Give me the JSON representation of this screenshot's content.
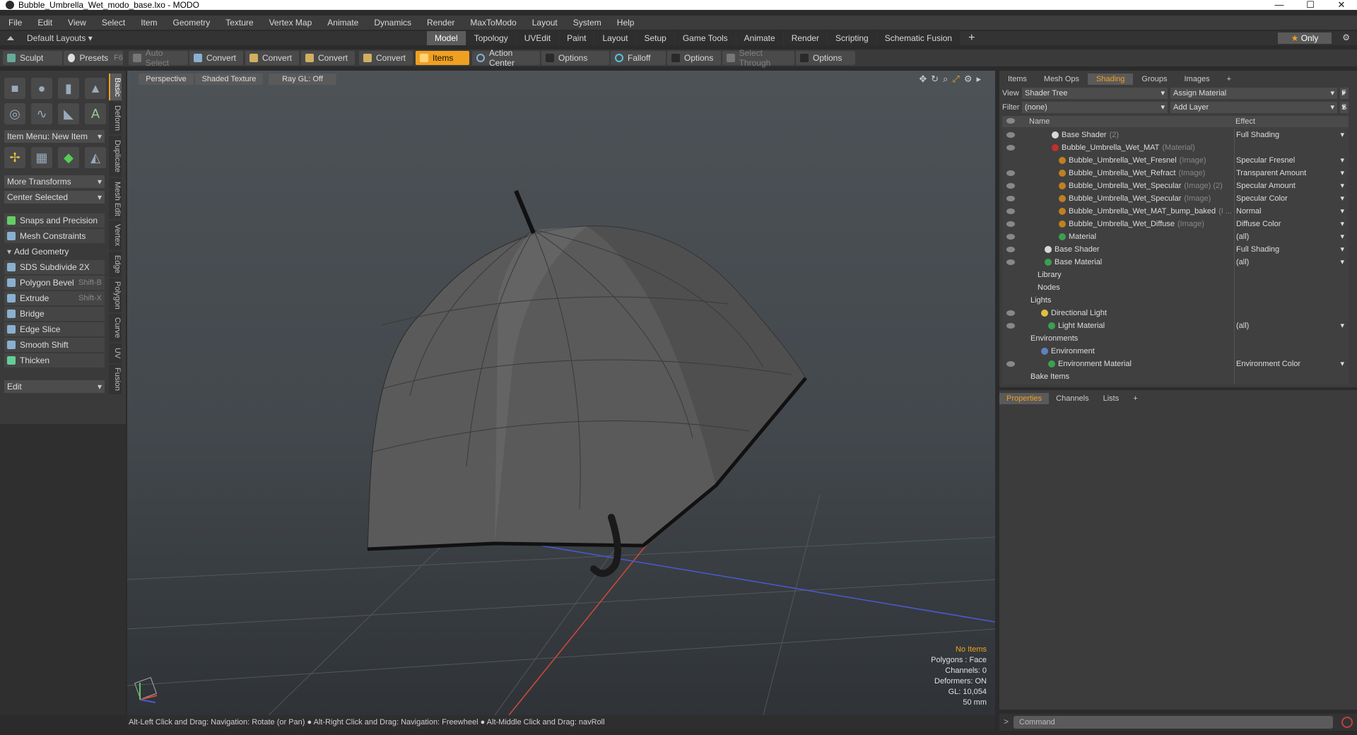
{
  "window": {
    "title": "Bubble_Umbrella_Wet_modo_base.lxo - MODO",
    "controls": [
      "—",
      "☐",
      "✕"
    ]
  },
  "menu": [
    "File",
    "Edit",
    "View",
    "Select",
    "Item",
    "Geometry",
    "Texture",
    "Vertex Map",
    "Animate",
    "Dynamics",
    "Render",
    "MaxToModo",
    "Layout",
    "System",
    "Help"
  ],
  "layoutbar": {
    "layouts_label": "Default Layouts ▾",
    "tabs": [
      "Model",
      "Topology",
      "UVEdit",
      "Paint",
      "Layout",
      "Setup",
      "Game Tools",
      "Animate",
      "Render",
      "Scripting",
      "Schematic Fusion"
    ],
    "active_tab": "Model",
    "add_tab": "+",
    "only_label": "Only"
  },
  "toolbar": {
    "sculpt": "Sculpt",
    "presets": "Presets",
    "presets_shortcut": "F6",
    "auto_select": "Auto Select",
    "convert1": "Convert",
    "convert2": "Convert",
    "convert3": "Convert",
    "convert4": "Convert",
    "items": "Items",
    "action_center": "Action Center",
    "options1": "Options",
    "falloff": "Falloff",
    "options2": "Options",
    "select_through": "Select Through",
    "options3": "Options"
  },
  "leftpanel": {
    "item_menu": "Item Menu: New Item",
    "more_transforms": "More Transforms",
    "center_selected": "Center Selected",
    "snaps": "Snaps and Precision",
    "mesh_constraints": "Mesh Constraints",
    "add_geometry": "Add Geometry",
    "tools": [
      {
        "label": "SDS Subdivide 2X",
        "shortcut": ""
      },
      {
        "label": "Polygon Bevel",
        "shortcut": "Shift-B"
      },
      {
        "label": "Extrude",
        "shortcut": "Shift-X"
      },
      {
        "label": "Bridge",
        "shortcut": ""
      },
      {
        "label": "Edge Slice",
        "shortcut": ""
      },
      {
        "label": "Smooth Shift",
        "shortcut": ""
      },
      {
        "label": "Thicken",
        "shortcut": ""
      }
    ],
    "edit": "Edit",
    "vtabs": [
      "Basic",
      "Deform",
      "Duplicate",
      "Mesh Edit",
      "Vertex",
      "Edge",
      "Polygon",
      "Curve",
      "UV",
      "Fusion"
    ]
  },
  "viewport": {
    "perspective": "Perspective",
    "shaded": "Shaded Texture",
    "raygl": "Ray GL: Off",
    "stats": {
      "no_items": "No Items",
      "polygons": "Polygons : Face",
      "channels": "Channels: 0",
      "deformers": "Deformers: ON",
      "gl": "GL: 10,054",
      "focal": "50 mm"
    }
  },
  "statusbar": "Alt-Left Click and Drag: Navigation: Rotate (or Pan) ● Alt-Right Click and Drag: Navigation: Freewheel ● Alt-Middle Click and Drag: navRoll",
  "shading": {
    "tabs": [
      "Items",
      "Mesh Ops",
      "Shading",
      "Groups",
      "Images",
      "+"
    ],
    "active_tab": "Shading",
    "view_label": "View",
    "view_value": "Shader Tree",
    "assign_material": "Assign Material",
    "f_btn": "F",
    "filter_label": "Filter",
    "filter_value": "(none)",
    "add_layer": "Add Layer",
    "s_btn": "S",
    "col_name": "Name",
    "col_effect": "Effect",
    "rows": [
      {
        "name": "Base Shader",
        "suffix": "(2)",
        "effect": "Full Shading",
        "indent": 1,
        "eye": true,
        "ball": "#d8d8d8"
      },
      {
        "name": "Bubble_Umbrella_Wet_MAT",
        "suffix": "(Material)",
        "effect": "",
        "indent": 1,
        "eye": true,
        "ball": "#c03030"
      },
      {
        "name": "Bubble_Umbrella_Wet_Fresnel",
        "suffix": "(Image)",
        "effect": "Specular Fresnel",
        "indent": 2,
        "eye": false,
        "ball": "#c08020"
      },
      {
        "name": "Bubble_Umbrella_Wet_Refract",
        "suffix": "(Image)",
        "effect": "Transparent Amount",
        "indent": 2,
        "eye": true,
        "ball": "#c08020"
      },
      {
        "name": "Bubble_Umbrella_Wet_Specular",
        "suffix": "(Image) (2)",
        "effect": "Specular Amount",
        "indent": 2,
        "eye": true,
        "ball": "#c08020"
      },
      {
        "name": "Bubble_Umbrella_Wet_Specular",
        "suffix": "(Image)",
        "effect": "Specular Color",
        "indent": 2,
        "eye": true,
        "ball": "#c08020"
      },
      {
        "name": "Bubble_Umbrella_Wet_MAT_bump_baked",
        "suffix": "(I ...",
        "effect": "Normal",
        "indent": 2,
        "eye": true,
        "ball": "#c08020"
      },
      {
        "name": "Bubble_Umbrella_Wet_Diffuse",
        "suffix": "(Image)",
        "effect": "Diffuse Color",
        "indent": 2,
        "eye": true,
        "ball": "#c08020"
      },
      {
        "name": "Material",
        "suffix": "",
        "effect": "(all)",
        "indent": 2,
        "eye": true,
        "ball": "#3aa050"
      },
      {
        "name": "Base Shader",
        "suffix": "",
        "effect": "Full Shading",
        "indent": 0,
        "eye": true,
        "ball": "#d8d8d8"
      },
      {
        "name": "Base Material",
        "suffix": "",
        "effect": "(all)",
        "indent": 0,
        "eye": true,
        "ball": "#3aa050"
      },
      {
        "name": "Library",
        "suffix": "",
        "effect": "",
        "indent": -1,
        "eye": false,
        "ball": ""
      },
      {
        "name": "Nodes",
        "suffix": "",
        "effect": "",
        "indent": -1,
        "eye": false,
        "ball": ""
      },
      {
        "name": "Lights",
        "suffix": "",
        "effect": "",
        "indent": -2,
        "eye": false,
        "ball": ""
      },
      {
        "name": "Directional Light",
        "suffix": "",
        "effect": "",
        "indent": -0.5,
        "eye": true,
        "ball": "#e0c040"
      },
      {
        "name": "Light Material",
        "suffix": "",
        "effect": "(all)",
        "indent": 0.5,
        "eye": true,
        "ball": "#3aa050"
      },
      {
        "name": "Environments",
        "suffix": "",
        "effect": "",
        "indent": -2,
        "eye": false,
        "ball": ""
      },
      {
        "name": "Environment",
        "suffix": "",
        "effect": "",
        "indent": -0.5,
        "eye": false,
        "ball": "#6080c0"
      },
      {
        "name": "Environment Material",
        "suffix": "",
        "effect": "Environment Color",
        "indent": 0.5,
        "eye": true,
        "ball": "#3aa050"
      },
      {
        "name": "Bake Items",
        "suffix": "",
        "effect": "",
        "indent": -2,
        "eye": false,
        "ball": ""
      }
    ]
  },
  "properties": {
    "tabs": [
      "Properties",
      "Channels",
      "Lists",
      "+"
    ],
    "active_tab": "Properties"
  },
  "command": {
    "arrow": ">",
    "placeholder": "Command"
  }
}
